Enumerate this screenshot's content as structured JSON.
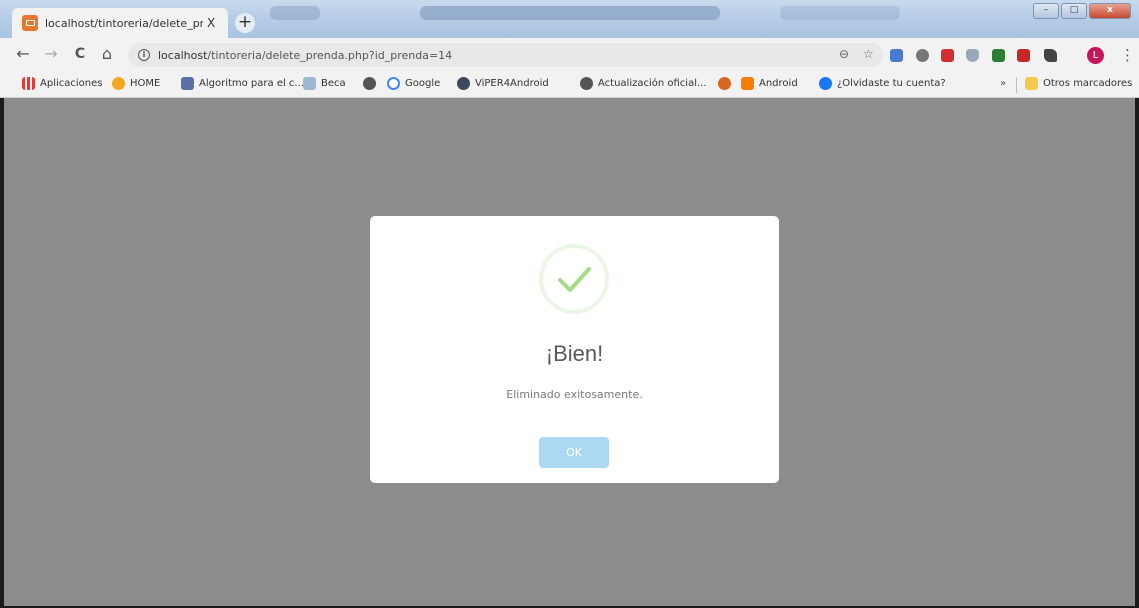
{
  "browser": {
    "tab": {
      "title": "localhost/tintoreria/delete_prenc",
      "close": "X",
      "favicon": "page-favicon"
    },
    "new_tab": "+",
    "window_controls": {
      "minimize": "–",
      "maximize": "□",
      "close": "x"
    },
    "toolbar": {
      "back": "←",
      "forward": "→",
      "reload": "C",
      "home": "⌂",
      "url_host": "localhost",
      "url_path": "/tintoreria/delete_prenda.php?id_prenda=14",
      "zoom": "⊖",
      "star": "☆",
      "menu": "⋮",
      "profile_initial": "L"
    },
    "bookmarks": {
      "items": [
        {
          "label": "Aplicaciones",
          "icon": "apps-grid-icon",
          "color": "#e53935"
        },
        {
          "label": "HOME",
          "icon": "home-bookmark-icon",
          "color": "#f5a623"
        },
        {
          "label": "Algoritmo para el c...",
          "icon": "doc-icon",
          "color": "#5b6fa8"
        },
        {
          "label": "Beca",
          "icon": "beca-icon",
          "color": "#9eb7d4"
        },
        {
          "label": "",
          "icon": "globe-icon",
          "color": "#555555"
        },
        {
          "label": "Google",
          "icon": "google-icon",
          "color": "#4285f4"
        },
        {
          "label": "ViPER4Android",
          "icon": "viper-icon",
          "color": "#3b4a5a"
        },
        {
          "label": "Actualización oficial...",
          "icon": "globe-icon",
          "color": "#555555"
        },
        {
          "label": "",
          "icon": "orange-icon",
          "color": "#d9661f"
        },
        {
          "label": "Android",
          "icon": "blogger-icon",
          "color": "#f57d00"
        },
        {
          "label": "¿Olvidaste tu cuenta?",
          "icon": "facebook-icon",
          "color": "#1877f2"
        }
      ],
      "more": "»",
      "other": "Otros marcadores"
    }
  },
  "dialog": {
    "icon": "success-check-icon",
    "title": "¡Bien!",
    "text": "Eliminado exitosamente.",
    "ok_label": "OK",
    "colors": {
      "check": "#a5dc86",
      "button": "#acd9f1",
      "overlay": "#8c8c8c"
    }
  }
}
